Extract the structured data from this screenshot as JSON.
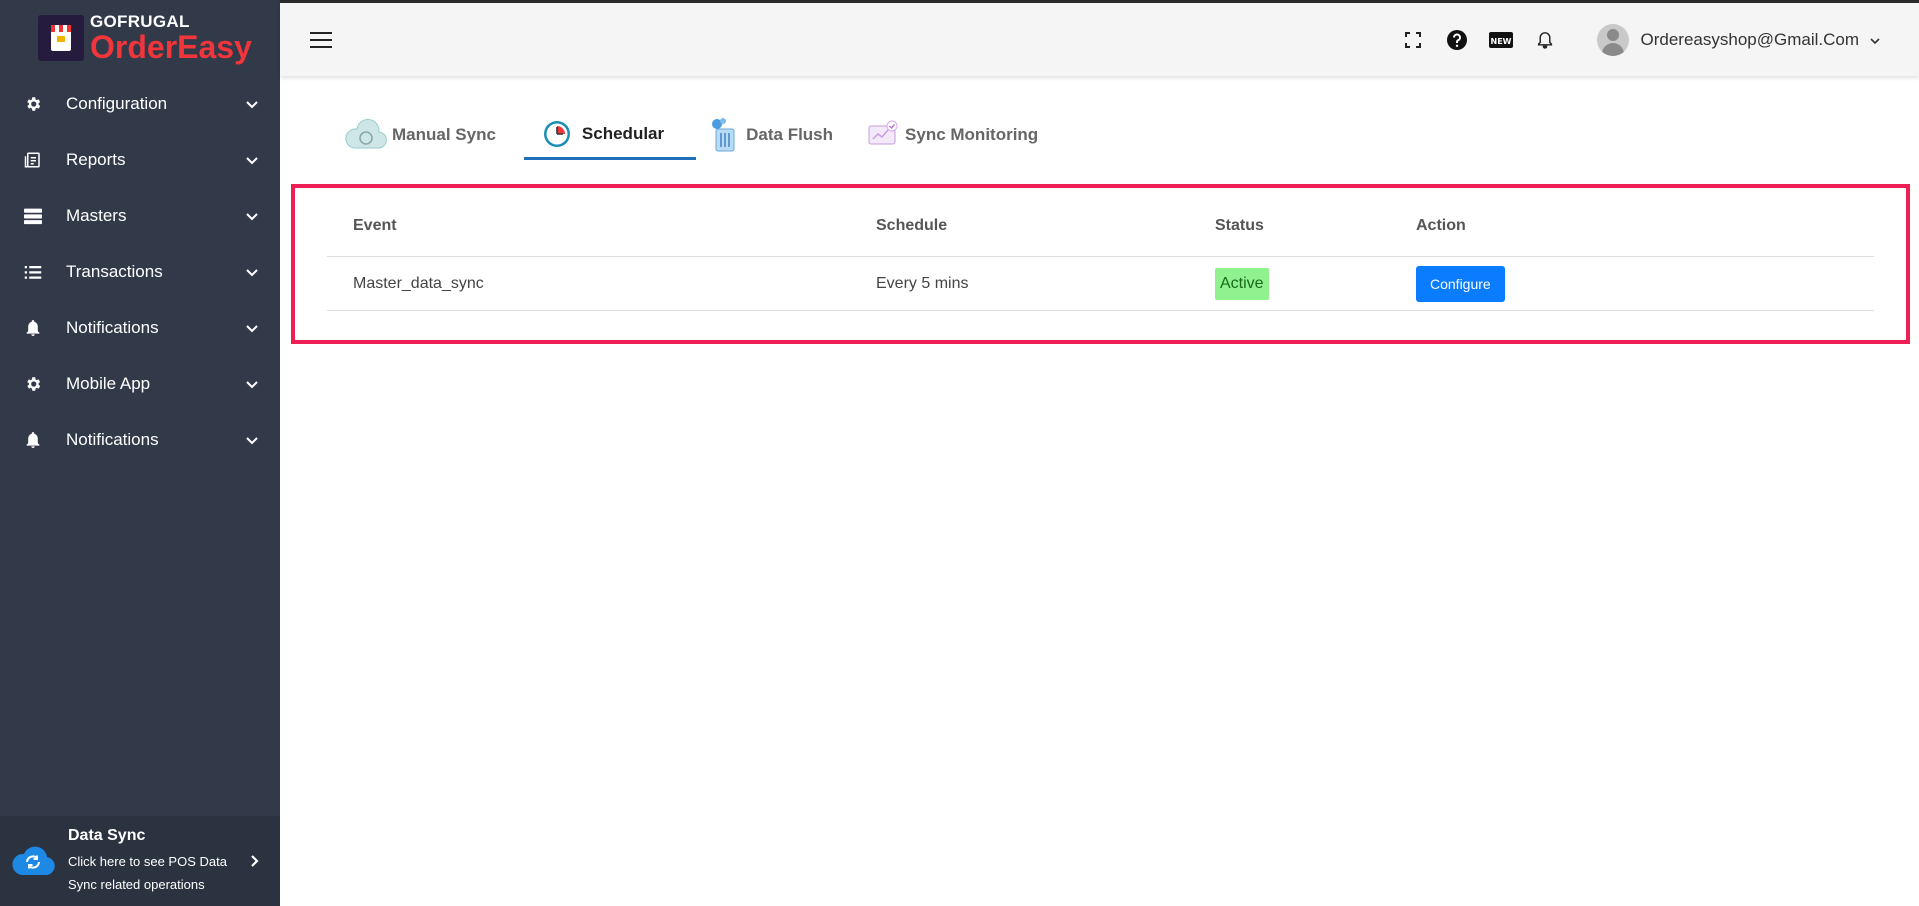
{
  "brand": {
    "top": "GOFRUGAL",
    "bottom": "OrderEasy"
  },
  "sidebar": {
    "items": [
      {
        "label": "Configuration",
        "icon": "gear-icon"
      },
      {
        "label": "Reports",
        "icon": "report-icon"
      },
      {
        "label": "Masters",
        "icon": "database-icon"
      },
      {
        "label": "Transactions",
        "icon": "list-icon"
      },
      {
        "label": "Notifications",
        "icon": "bell-icon"
      },
      {
        "label": "Mobile App",
        "icon": "gear-icon"
      },
      {
        "label": "Notifications",
        "icon": "bell-icon"
      }
    ],
    "data_sync": {
      "title": "Data Sync",
      "subtitle_line1": "Click here to see POS Data",
      "subtitle_line2": "Sync related operations"
    }
  },
  "header": {
    "user_email": "Ordereasyshop@Gmail.Com",
    "new_badge": "NEW"
  },
  "tabs": [
    {
      "label": "Manual Sync",
      "active": false
    },
    {
      "label": "Schedular",
      "active": true
    },
    {
      "label": "Data Flush",
      "active": false
    },
    {
      "label": "Sync Monitoring",
      "active": false
    }
  ],
  "table": {
    "headers": [
      "Event",
      "Schedule",
      "Status",
      "Action"
    ],
    "rows": [
      {
        "event": "Master_data_sync",
        "schedule": "Every 5 mins",
        "status": "Active",
        "action": "Configure"
      }
    ]
  },
  "colors": {
    "sidebar_bg": "#323a4a",
    "accent": "#1e6fb8",
    "highlight": "#ee1f54",
    "button": "#0a7cff",
    "status_active": "#8ff28f",
    "brand_red": "#f0353b"
  }
}
